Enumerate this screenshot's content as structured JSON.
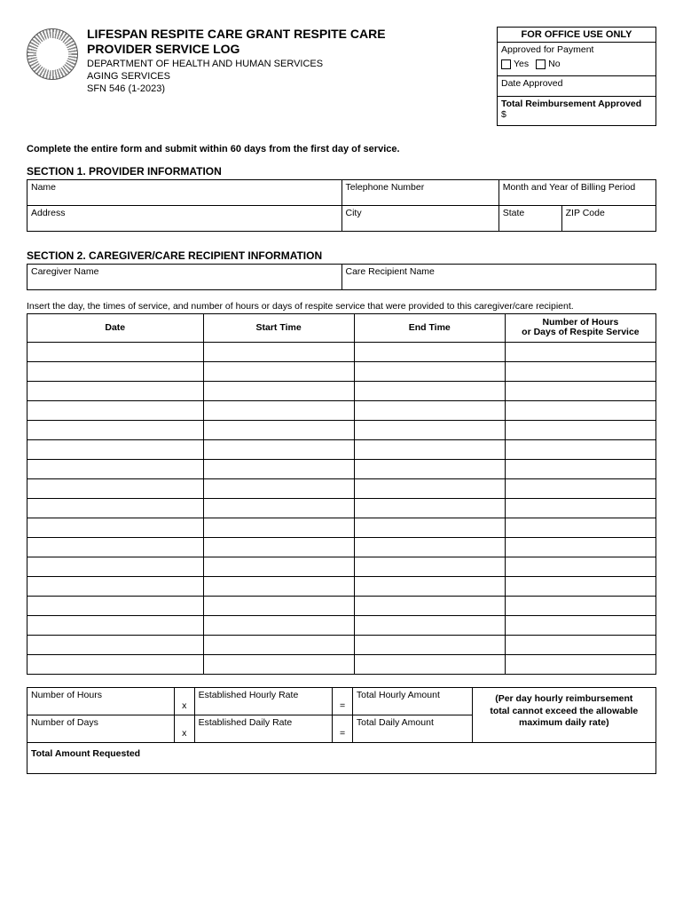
{
  "header": {
    "title_line1": "LIFESPAN RESPITE CARE GRANT RESPITE CARE",
    "title_line2": "PROVIDER SERVICE LOG",
    "dept": "DEPARTMENT OF HEALTH AND HUMAN SERVICES",
    "division": "AGING SERVICES",
    "form_id": "SFN 546 (1-2023)"
  },
  "office": {
    "heading": "FOR OFFICE USE ONLY",
    "approved_label": "Approved for Payment",
    "yes": "Yes",
    "no": "No",
    "date_approved": "Date Approved",
    "total_reimb": "Total Reimbursement Approved",
    "dollar": "$"
  },
  "instruction": "Complete the entire form and submit within 60 days from the first day of service.",
  "section1": {
    "heading": "SECTION 1.  PROVIDER INFORMATION",
    "name": "Name",
    "phone": "Telephone Number",
    "billing": "Month and Year of Billing Period",
    "address": "Address",
    "city": "City",
    "state": "State",
    "zip": "ZIP Code"
  },
  "section2": {
    "heading": "SECTION 2.  CAREGIVER/CARE RECIPIENT INFORMATION",
    "caregiver": "Caregiver Name",
    "recipient": "Care Recipient Name",
    "insert": "Insert the day, the times of service, and number of hours or days of respite service that were provided to this caregiver/care recipient."
  },
  "log": {
    "col_date": "Date",
    "col_start": "Start Time",
    "col_end": "End Time",
    "col_hours_l1": "Number of Hours",
    "col_hours_l2": "or Days of Respite Service",
    "row_count": 17
  },
  "calc": {
    "num_hours": "Number of Hours",
    "rate_hourly": "Established Hourly Rate",
    "total_hourly": "Total Hourly Amount",
    "num_days": "Number of Days",
    "rate_daily": "Established Daily Rate",
    "total_daily": "Total Daily Amount",
    "op_x": "x",
    "op_eq": "=",
    "note_l1": "(Per day hourly reimbursement",
    "note_l2": "total cannot exceed the allowable",
    "note_l3": "maximum daily rate)",
    "total_req": "Total Amount Requested"
  }
}
